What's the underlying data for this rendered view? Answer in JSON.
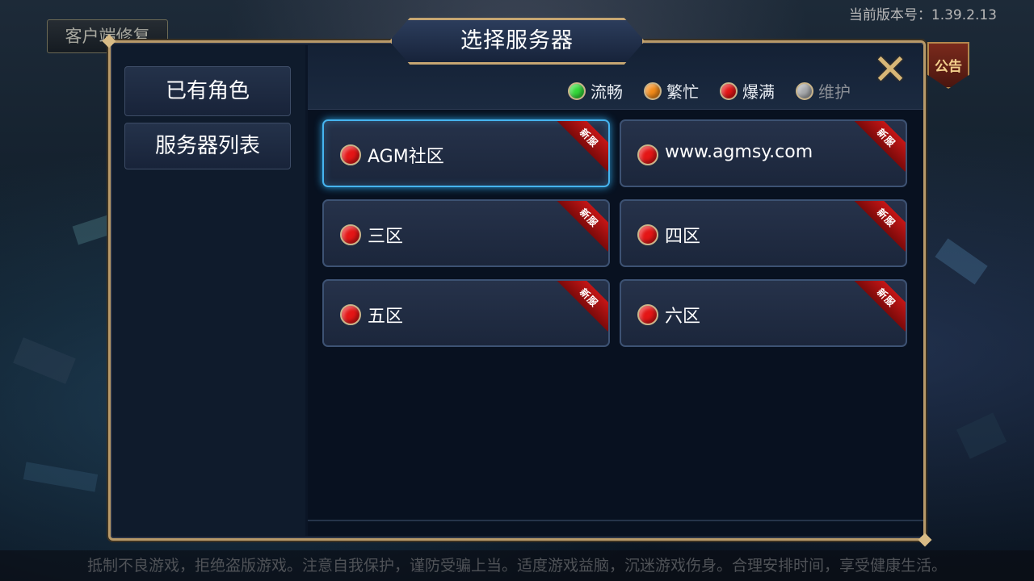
{
  "top_bar": {
    "repair_button": "客户端修复",
    "version_text": "当前版本号：1.39.2.13",
    "notice_label": "公告"
  },
  "dialog": {
    "title": "选择服务器",
    "close_icon": "close-x-icon",
    "sidebar": {
      "items": [
        {
          "label": "已有角色"
        },
        {
          "label": "服务器列表"
        }
      ]
    },
    "legend": [
      {
        "label": "流畅",
        "color": "#34d93a"
      },
      {
        "label": "繁忙",
        "color": "#f28b1a"
      },
      {
        "label": "爆满",
        "color": "#e41616"
      },
      {
        "label": "维护",
        "color": "#a7a9ac"
      }
    ],
    "servers": [
      {
        "name": "AGM社区",
        "status": "爆满",
        "tag": "新服",
        "selected": true
      },
      {
        "name": "www.agmsy.com",
        "status": "爆满",
        "tag": "新服",
        "selected": false
      },
      {
        "name": "三区",
        "status": "爆满",
        "tag": "新服",
        "selected": false
      },
      {
        "name": "四区",
        "status": "爆满",
        "tag": "新服",
        "selected": false
      },
      {
        "name": "五区",
        "status": "爆满",
        "tag": "新服",
        "selected": false
      },
      {
        "name": "六区",
        "status": "爆满",
        "tag": "新服",
        "selected": false
      }
    ]
  },
  "footer": {
    "text": "抵制不良游戏，拒绝盗版游戏。注意自我保护，谨防受骗上当。适度游戏益脑，沉迷游戏伤身。合理安排时间，享受健康生活。"
  }
}
